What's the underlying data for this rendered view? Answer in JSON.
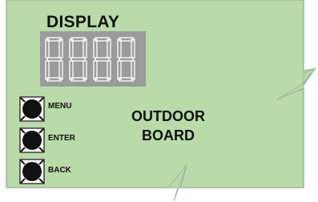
{
  "board": {
    "display_label": "DISPLAY",
    "board_label_line1": "OUTDOOR",
    "board_label_line2": "BOARD"
  },
  "buttons": {
    "menu": "MENU",
    "enter": "ENTER",
    "back": "BACK"
  },
  "display": {
    "digit_count": 4
  },
  "colors": {
    "board_fill": "#b9daa9",
    "board_stroke": "#9fb5a0",
    "display_fill": "#9b9b9b",
    "segment": "#ffffff",
    "button_fill": "#111111"
  }
}
